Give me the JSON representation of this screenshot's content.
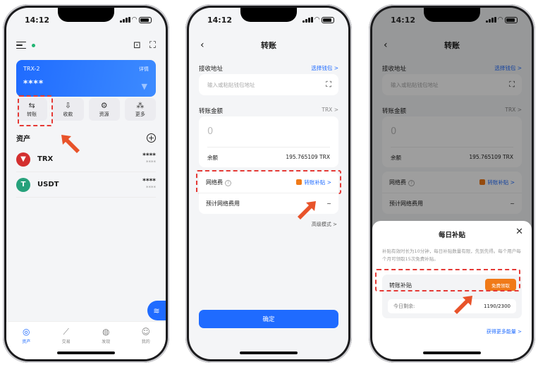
{
  "status_time": "14:12",
  "phone1": {
    "wallet_name": "TRX-2",
    "wallet_balance": "****",
    "detail_label": "详情",
    "actions": [
      {
        "label": "转账",
        "icon": "transfer-icon",
        "glyph": "⇆"
      },
      {
        "label": "收款",
        "icon": "receive-icon",
        "glyph": "⇩"
      },
      {
        "label": "资源",
        "icon": "resource-chip-icon",
        "glyph": "⚙"
      },
      {
        "label": "更多",
        "icon": "grid-icon",
        "glyph": "⁂"
      }
    ],
    "assets_title": "资产",
    "assets": [
      {
        "symbol": "TRX",
        "amount": "****",
        "value": "****",
        "color": "#d32f2f",
        "glyph": "▼"
      },
      {
        "symbol": "USDT",
        "amount": "****",
        "value": "****",
        "color": "#26a17b",
        "glyph": "T"
      }
    ],
    "tabs": [
      {
        "label": "资产",
        "icon": "assets-icon",
        "glyph": "◎"
      },
      {
        "label": "交易",
        "icon": "trade-chart-icon",
        "glyph": "⟋"
      },
      {
        "label": "发现",
        "icon": "globe-icon",
        "glyph": "◍"
      },
      {
        "label": "我的",
        "icon": "profile-icon",
        "glyph": "☺"
      }
    ]
  },
  "transfer": {
    "title": "转账",
    "recipient_label": "接收地址",
    "select_wallet": "选择钱包 >",
    "recipient_placeholder": "输入或粘贴钱包地址",
    "amount_label": "转账金额",
    "token": "TRX >",
    "amount_value": "0",
    "balance_label": "余额",
    "balance_value": "195.765109 TRX",
    "fee_label": "网络费",
    "fee_subsidy_link": "转账补贴 >",
    "estimated_fee_label": "预计网络费用",
    "estimated_fee_value": "~",
    "advanced_mode": "高级模式 >",
    "confirm_label": "确定"
  },
  "sheet": {
    "title": "每日补贴",
    "description": "补贴有效时长为10分钟，每日补贴数量有限，先到先得。每个用户每个月可领取15次免费补贴。",
    "subsidy_label": "转账补贴",
    "claim_button": "免费领取",
    "remaining_label": "今日剩余:",
    "remaining_value": "1190/2300",
    "more_energy_link": "获得更多能量 >"
  },
  "colors": {
    "accent": "#1f6bff",
    "highlight": "#e53935",
    "claim": "#f07a18"
  }
}
